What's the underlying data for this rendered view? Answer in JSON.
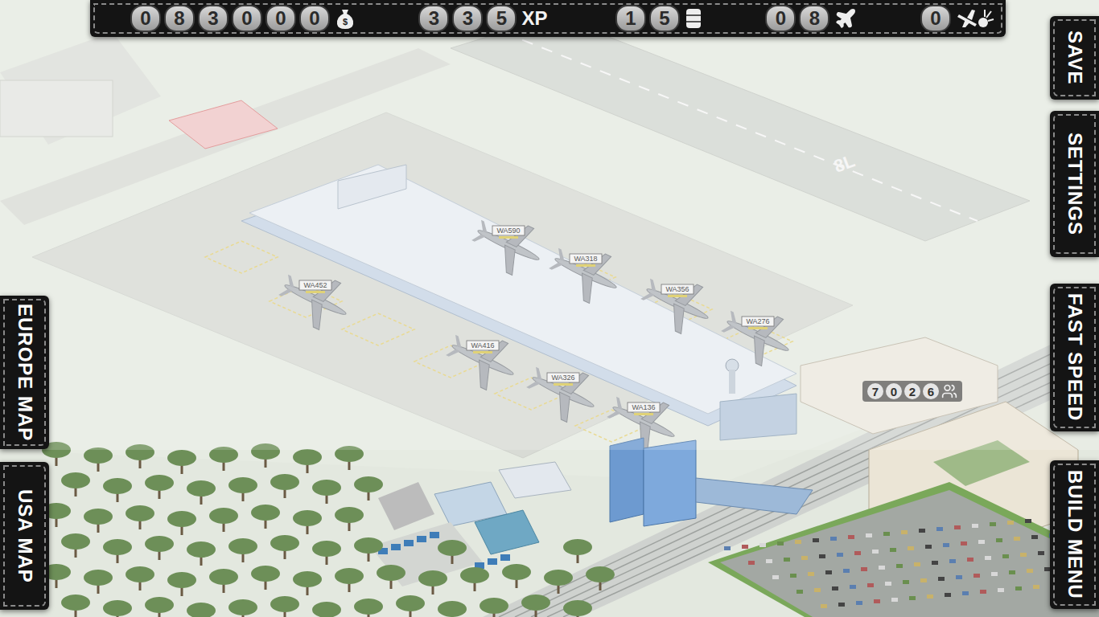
{
  "hud": {
    "counters": [
      {
        "kind": "money",
        "value": "083000",
        "unit": ""
      },
      {
        "kind": "xp",
        "value": "335",
        "unit": "XP"
      },
      {
        "kind": "fuel",
        "value": "15",
        "unit": ""
      },
      {
        "kind": "planes",
        "value": "08",
        "unit": ""
      },
      {
        "kind": "crashes",
        "value": "0",
        "unit": ""
      }
    ]
  },
  "left_buttons": [
    "EUROPE MAP",
    "USA MAP"
  ],
  "right_buttons": [
    "SAVE",
    "SETTINGS",
    "FAST SPEED",
    "BUILD MENU"
  ],
  "passengers": "7026",
  "runway_label": "8L",
  "flights": [
    {
      "code": "WA590"
    },
    {
      "code": "WA318"
    },
    {
      "code": "WA356"
    },
    {
      "code": "WA276"
    },
    {
      "code": "WA452"
    },
    {
      "code": "WA416"
    },
    {
      "code": "WA326"
    },
    {
      "code": "WA136"
    }
  ]
}
